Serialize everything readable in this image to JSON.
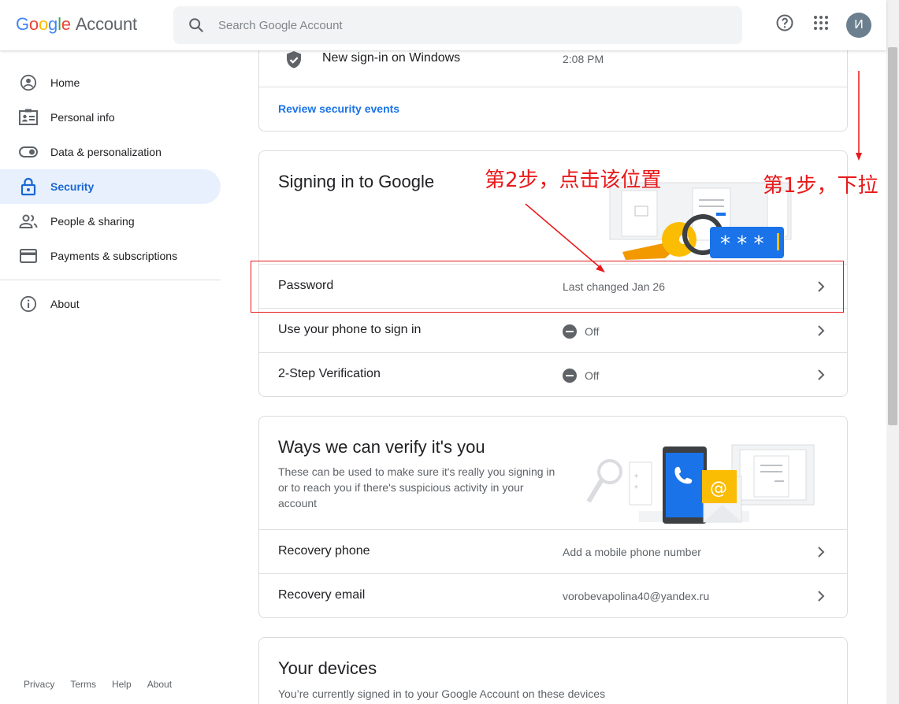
{
  "header": {
    "logo_google": [
      "G",
      "o",
      "o",
      "g",
      "l",
      "e"
    ],
    "logo_account": "Account",
    "search_placeholder": "Search Google Account",
    "avatar_letter": "И"
  },
  "sidebar": {
    "items": [
      {
        "label": "Home",
        "icon": "home-icon"
      },
      {
        "label": "Personal info",
        "icon": "id-card-icon"
      },
      {
        "label": "Data & personalization",
        "icon": "toggle-icon"
      },
      {
        "label": "Security",
        "icon": "lock-icon",
        "active": true
      },
      {
        "label": "People & sharing",
        "icon": "people-icon"
      },
      {
        "label": "Payments & subscriptions",
        "icon": "credit-card-icon"
      }
    ],
    "about": "About",
    "footer": [
      "Privacy",
      "Terms",
      "Help",
      "About"
    ]
  },
  "events_card": {
    "event_label": "New sign-in on Windows",
    "event_time": "2:08 PM",
    "review_link": "Review security events"
  },
  "signin_card": {
    "title": "Signing in to Google",
    "rows": [
      {
        "label": "Password",
        "value": "Last changed Jan 26"
      },
      {
        "label": "Use your phone to sign in",
        "value": "Off"
      },
      {
        "label": "2-Step Verification",
        "value": "Off"
      }
    ]
  },
  "verify_card": {
    "title": "Ways we can verify it's you",
    "desc_lines": [
      "These can be used to make sure it's really you signing in",
      "or to reach you if there's suspicious activity in your",
      "account"
    ],
    "rows": [
      {
        "label": "Recovery phone",
        "value": "Add a mobile phone number"
      },
      {
        "label": "Recovery email",
        "value": "vorobevapolina40@yandex.ru"
      }
    ]
  },
  "devices_card": {
    "title": "Your devices",
    "desc": "You’re currently signed in to your Google Account on these devices"
  },
  "annotations": {
    "step2": "第2步，点击该位置",
    "step1": "第1步，下拉"
  },
  "colors": {
    "annotation": "#e8191a",
    "accent": "#1a73e8",
    "active_bg": "#e8f0fe"
  }
}
